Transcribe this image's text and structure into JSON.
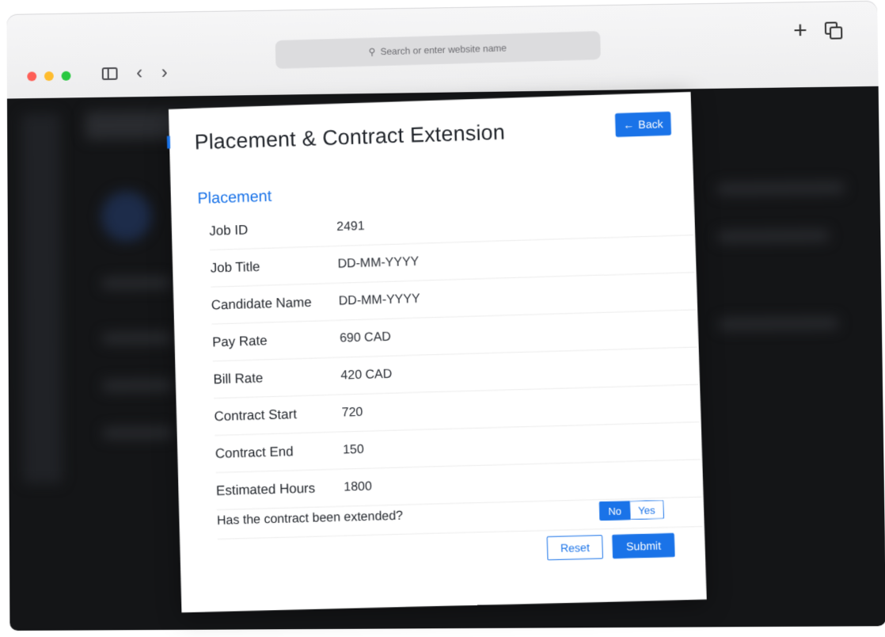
{
  "browser": {
    "address_placeholder": "Search or enter website name",
    "icons": [
      "sidebar-toggle-icon",
      "back-chevron-icon",
      "forward-chevron-icon",
      "search-icon",
      "new-tab-plus-icon",
      "tabs-overview-icon"
    ]
  },
  "modal": {
    "title": "Placement & Contract Extension",
    "back_label": "Back",
    "section_title": "Placement",
    "fields": [
      {
        "label": "Job ID",
        "value": "2491"
      },
      {
        "label": "Job Title",
        "value": "DD-MM-YYYY"
      },
      {
        "label": "Candidate Name",
        "value": "DD-MM-YYYY"
      },
      {
        "label": "Pay Rate",
        "value": "690 CAD"
      },
      {
        "label": "Bill Rate",
        "value": "420 CAD"
      },
      {
        "label": "Contract Start",
        "value": "720"
      },
      {
        "label": "Contract End",
        "value": "150"
      },
      {
        "label": "Estimated Hours",
        "value": "1800"
      }
    ],
    "extension_question": "Has the contract been extended?",
    "toggle": {
      "no_label": "No",
      "yes_label": "Yes",
      "selected": "No"
    },
    "reset_label": "Reset",
    "submit_label": "Submit"
  },
  "colors": {
    "accent": "#1a73e8",
    "page_background": "#141517"
  }
}
